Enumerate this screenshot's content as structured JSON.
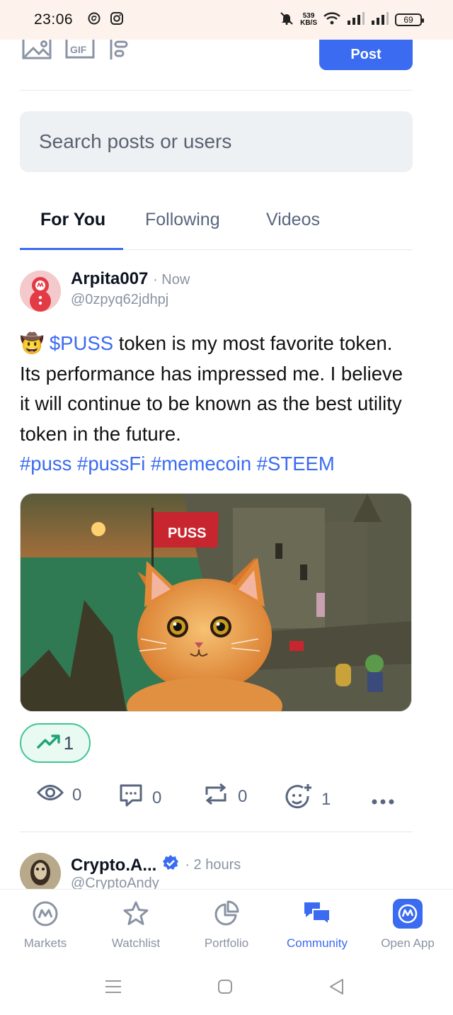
{
  "status_bar": {
    "time": "23:06",
    "net_speed_value": "539",
    "net_speed_unit": "KB/S",
    "battery": "69"
  },
  "composer": {
    "post_label": "Post"
  },
  "search": {
    "placeholder": "Search posts or users"
  },
  "tabs": [
    {
      "label": "For You"
    },
    {
      "label": "Following"
    },
    {
      "label": "Videos"
    }
  ],
  "post": {
    "author": "Arpita007",
    "time": "· Now",
    "handle": "@0zpyq62jdhpj",
    "emoji": "🤠",
    "cashtag": "$PUSS",
    "text": " token is my most favorite token. Its performance has impressed me. I believe it will continue to be known as the best utility token in the future. ",
    "hashtags": [
      "#puss",
      "#pussFi",
      "#memecoin",
      "#STEEM"
    ],
    "image_flag_text": "PUSS",
    "trend_count": "1",
    "stats": {
      "views": "0",
      "comments": "0",
      "reposts": "0",
      "reactions": "1"
    }
  },
  "next_post": {
    "author": "Crypto.A...",
    "time": "· 2 hours",
    "handle": "@CryptoAndy"
  },
  "bottom_nav": [
    {
      "label": "Markets",
      "icon": "cmc-logo-icon"
    },
    {
      "label": "Watchlist",
      "icon": "star-icon"
    },
    {
      "label": "Portfolio",
      "icon": "pie-chart-icon"
    },
    {
      "label": "Community",
      "icon": "chat-bubbles-icon"
    },
    {
      "label": "Open App",
      "icon": "cmc-app-icon"
    }
  ],
  "colors": {
    "accent": "#3a6bf0",
    "trend": "#3fc592",
    "muted": "#8a93a3"
  }
}
